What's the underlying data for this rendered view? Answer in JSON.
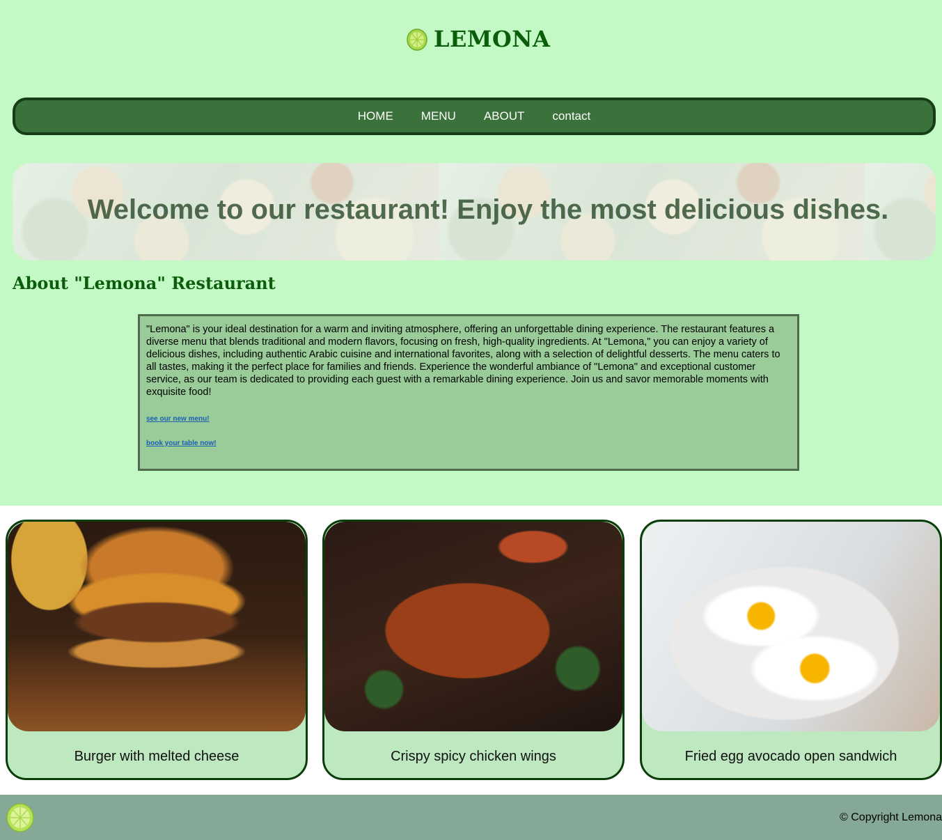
{
  "header": {
    "brand": "LEMONA",
    "logo_icon": "lemon-icon"
  },
  "nav": {
    "items": [
      "HOME",
      "MENU",
      "ABOUT",
      "contact"
    ]
  },
  "banner": {
    "text": "Welcome to our restaurant! Enjoy the most delicious dishes."
  },
  "about": {
    "title": "About \"Lemona\" Restaurant",
    "body": "\"Lemona\" is your ideal destination for a warm and inviting atmosphere, offering an unforgettable dining experience. The restaurant features a diverse menu that blends traditional and modern flavors, focusing on fresh, high-quality ingredients. At \"Lemona,\" you can enjoy a variety of delicious dishes, including authentic Arabic cuisine and international favorites, along with a selection of delightful desserts. The menu caters to all tastes, making it the perfect place for families and friends. Experience the wonderful ambiance of \"Lemona\" and exceptional customer service, as our team is dedicated to providing each guest with a remarkable dining experience. Join us and savor memorable moments with exquisite food!",
    "link_menu": "see our new menu!",
    "link_book": "book your table now!"
  },
  "cards": [
    {
      "label": "Burger with melted cheese"
    },
    {
      "label": "Crispy spicy chicken wings"
    },
    {
      "label": "Fried egg avocado open sandwich"
    }
  ],
  "footer": {
    "copyright": "© Copyright Lemona"
  },
  "colors": {
    "background": "#c3f9c5",
    "nav": "#3b713b",
    "brand": "#0b5d0b",
    "footer": "#86a997"
  }
}
